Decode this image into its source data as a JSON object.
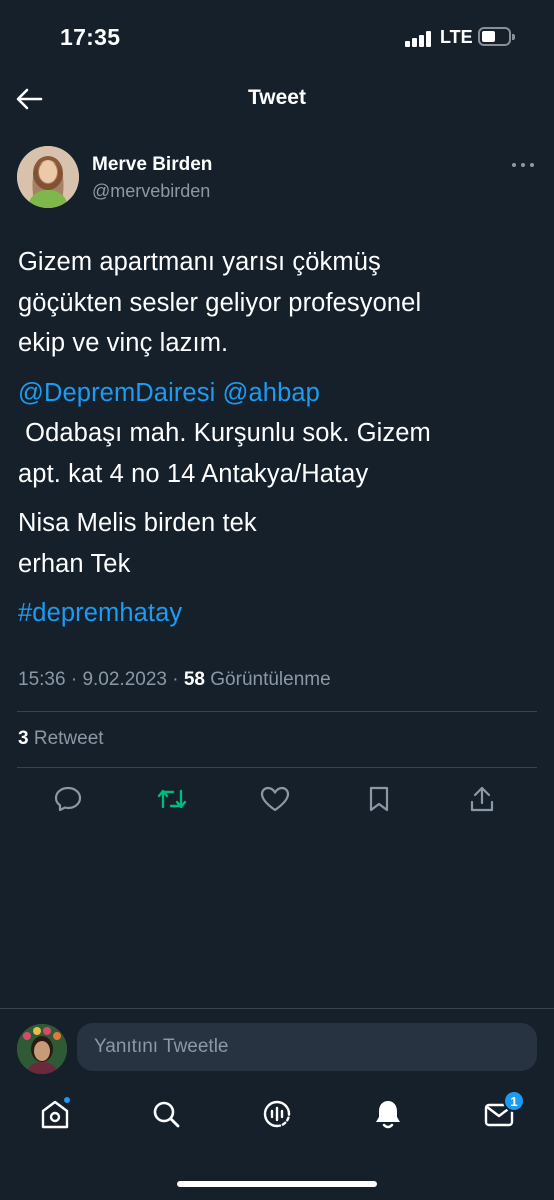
{
  "status_bar": {
    "time": "17:35",
    "network": "LTE",
    "signal_bars": 4,
    "battery_level": 0.45
  },
  "header": {
    "title": "Tweet",
    "back_icon": "arrow-left-icon"
  },
  "tweet": {
    "author_name": "Merve Birden",
    "author_handle": "@mervebirden",
    "lines": [
      "Gizem apartmanı yarısı çökmüş",
      "göçükten sesler geliyor profesyonel",
      "ekip ve vinç lazım."
    ],
    "mention_1": "@DepremDairesi",
    "mention_2": "@ahbap",
    "address_1": " Odabaşı mah. Kurşunlu sok. Gizem",
    "address_2": "apt. kat 4 no 14 Antakya/Hatay",
    "names_1": "Nisa Melis birden tek",
    "names_2": "erhan Tek",
    "hashtag": "#depremhatay",
    "time": "15:36",
    "date": "9.02.2023",
    "views_count": "58",
    "views_label": "Görüntülenme",
    "retweet_count": "3",
    "retweet_label": "Retweet"
  },
  "actions": [
    "reply-icon",
    "retweet-icon",
    "like-icon",
    "bookmark-icon",
    "share-icon"
  ],
  "reply": {
    "placeholder": "Yanıtını Tweetle"
  },
  "nav": {
    "items": [
      "home-icon",
      "search-icon",
      "spaces-icon",
      "notifications-icon",
      "messages-icon"
    ],
    "messages_badge": "1"
  },
  "colors": {
    "background": "#15202b",
    "accent": "#1d9bf0",
    "retweet_green": "#00ba7c",
    "muted": "#8b98a5"
  }
}
